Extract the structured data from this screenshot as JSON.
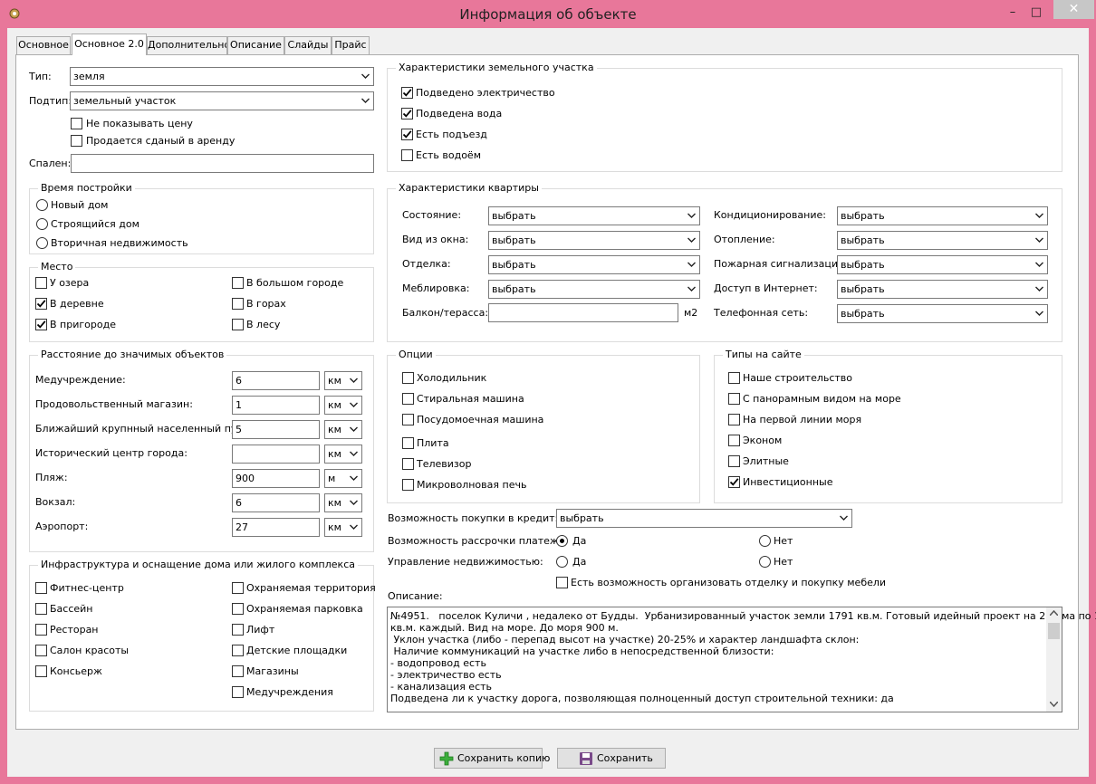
{
  "window": {
    "title": "Информация об объекте",
    "minimize": "–",
    "maximize": "□",
    "close": "✕",
    "app_icon": "gear-app-icon"
  },
  "tabs": [
    "Основное",
    "Основное 2.0",
    "Дополнительно",
    "Описание",
    "Слайды",
    "Прайс"
  ],
  "active_tab": "Основное 2.0",
  "left": {
    "type_label": "Тип:",
    "type_value": "земля",
    "subtype_label": "Подтип:",
    "subtype_value": "земельный участок",
    "hide_price": "Не показывать цену",
    "for_rent": "Продается сданый в аренду",
    "bedrooms_label": "Спален:",
    "bedrooms_value": ""
  },
  "build_time": {
    "title": "Время постройки",
    "options": [
      "Новый дом",
      "Строящийся дом",
      "Вторичная недвижимость"
    ]
  },
  "place": {
    "title": "Место",
    "left": [
      "У озера",
      "В деревне",
      "В пригороде"
    ],
    "right": [
      "В большом городе",
      "В горах",
      "В лесу"
    ],
    "checked": [
      "В деревне",
      "В пригороде"
    ]
  },
  "distances": {
    "title": "Расстояние до значимых объектов",
    "rows": [
      {
        "label": "Медучреждение:",
        "value": "6",
        "unit": "км"
      },
      {
        "label": "Продовольственный магазин:",
        "value": "1",
        "unit": "км"
      },
      {
        "label": "Ближайший крупнный населенный пункт:",
        "value": "5",
        "unit": "км"
      },
      {
        "label": "Исторический центр города:",
        "value": "",
        "unit": "км"
      },
      {
        "label": "Пляж:",
        "value": "900",
        "unit": "м"
      },
      {
        "label": "Вокзал:",
        "value": "6",
        "unit": "км"
      },
      {
        "label": "Аэропорт:",
        "value": "27",
        "unit": "км"
      }
    ]
  },
  "infra": {
    "title": "Инфраструктура и оснащение дома или жилого комплекса",
    "left": [
      "Фитнес-центр",
      "Бассейн",
      "Ресторан",
      "Салон красоты",
      "Консьерж"
    ],
    "right": [
      "Охраняемая территория",
      "Охраняемая парковка",
      "Лифт",
      "Детские площадки",
      "Магазины",
      "Медучреждения"
    ]
  },
  "land": {
    "title": "Характеристики земельного участка",
    "items": [
      "Подведено электричество",
      "Подведена вода",
      "Есть подъезд",
      "Есть водоём"
    ],
    "checked": [
      "Подведено электричество",
      "Подведена вода",
      "Есть подъезд"
    ]
  },
  "apartment": {
    "title": "Характеристики квартиры",
    "left": [
      {
        "label": "Состояние:",
        "value": "выбрать"
      },
      {
        "label": "Вид из окна:",
        "value": "выбрать"
      },
      {
        "label": "Отделка:",
        "value": "выбрать"
      },
      {
        "label": "Меблировка:",
        "value": "выбрать"
      }
    ],
    "balcony_label": "Балкон/терасса:",
    "balcony_value": "",
    "balcony_unit": "м2",
    "right": [
      {
        "label": "Кондиционирование:",
        "value": "выбрать"
      },
      {
        "label": "Отопление:",
        "value": "выбрать"
      },
      {
        "label": "Пожарная сигнализация:",
        "value": "выбрать"
      },
      {
        "label": "Доступ в Интернет:",
        "value": "выбрать"
      },
      {
        "label": "Телефонная сеть:",
        "value": "выбрать"
      }
    ]
  },
  "options": {
    "title": "Опции",
    "items": [
      "Холодильник",
      "Стиральная машина",
      "Посудомоечная машина",
      "Плита",
      "Телевизор",
      "Микроволновая печь"
    ]
  },
  "site_types": {
    "title": "Типы на сайте",
    "items": [
      "Наше строительство",
      "С панорамным видом на море",
      "На первой линии моря",
      "Эконом",
      "Элитные",
      "Инвестиционные"
    ],
    "checked": [
      "Инвестиционные"
    ]
  },
  "credit": {
    "label": "Возможность покупки в кредит:",
    "value": "выбрать"
  },
  "installment": {
    "label": "Возможность рассрочки платежа:",
    "yes": "Да",
    "no": "Нет",
    "selected": "Да"
  },
  "management": {
    "label": "Управление недвижимостью:",
    "yes": "Да",
    "no": "Нет",
    "selected": ""
  },
  "furniture": "Есть возможность организовать отделку и покупку мебели",
  "description": {
    "label": "Описание:",
    "lines": [
      "№4951.   поселок Куличи , недалеко от Будды.  Урбанизированный участок земли 1791 кв.м. Готовый идейный проект на 2 дома по 180",
      "кв.м. каждый. Вид на море. До моря 900 м.",
      " Уклон участка (либо - перепад высот на участке) 20-25% и характер ландшафта склон:",
      " Наличие коммуникаций на участке либо в непосредственной близости:",
      "- водопровод есть",
      "- электричество есть",
      "- канализация есть",
      "Подведена ли к участку дорога, позволяющая полноценный доступ строительной техники: да"
    ]
  },
  "buttons": {
    "save_copy": "Сохранить копию",
    "save": "Сохранить"
  }
}
